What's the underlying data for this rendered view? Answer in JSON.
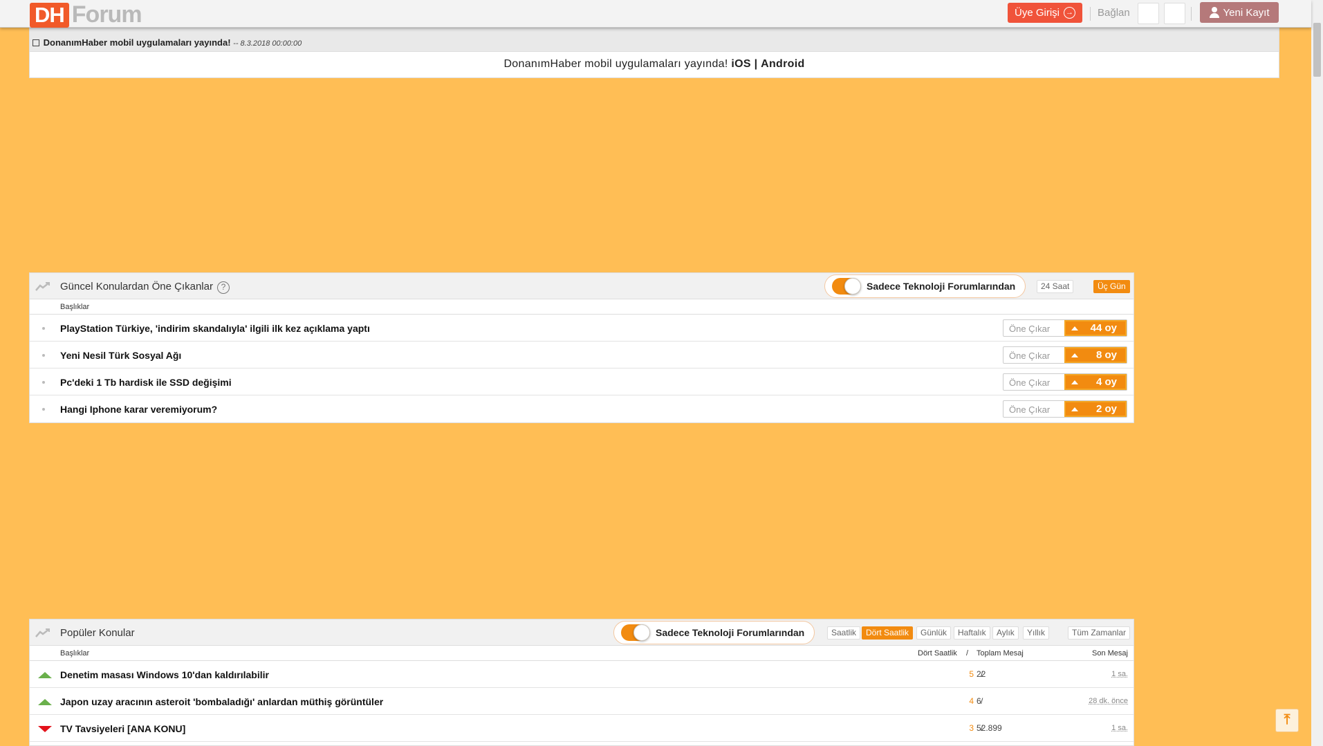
{
  "header": {
    "logo_dh": "DH",
    "logo_forum": "Forum",
    "login_label": "Üye Girişi",
    "connect_label": "Bağlan",
    "register_label": "Yeni Kayıt"
  },
  "announcement": {
    "title": "DonanımHaber mobil uygulamaları yayında!",
    "date": "-- 8.3.2018 00:00:00",
    "body_text": "DonanımHaber mobil uygulamaları yayında!",
    "ios": "iOS",
    "separator": "|",
    "android": "Android"
  },
  "featured": {
    "title": "Güncel Konulardan Öne Çıkanlar",
    "help": "?",
    "toggle_label": "Sadece Teknoloji Forumlarından",
    "toggle_on": true,
    "tabs": [
      {
        "label": "24 Saat",
        "active": false
      },
      {
        "label": "Üç Gün",
        "active": true
      }
    ],
    "col_header": "Başlıklar",
    "vote_label": "Öne Çıkar",
    "rows": [
      {
        "title": "PlayStation Türkiye, 'indirim skandalıyla' ilgili ilk kez açıklama yaptı",
        "votes": "44 oy"
      },
      {
        "title": "Yeni Nesil Türk Sosyal Ağı",
        "votes": "8 oy"
      },
      {
        "title": "Pc'deki 1 Tb hardisk ile SSD değişimi",
        "votes": "4 oy"
      },
      {
        "title": "Hangi Iphone karar veremiyorum?",
        "votes": "2 oy"
      }
    ]
  },
  "popular": {
    "title": "Popüler Konular",
    "toggle_label": "Sadece Teknoloji Forumlarından",
    "toggle_on": true,
    "tabs": [
      {
        "label": "Saatlik",
        "active": false
      },
      {
        "label": "Dört Saatlik",
        "active": true
      },
      {
        "label": "Günlük",
        "active": false
      },
      {
        "label": "Haftalık",
        "active": false
      },
      {
        "label": "Aylık",
        "active": false
      },
      {
        "label": "Yıllık",
        "active": false
      },
      {
        "label": "Tüm Zamanlar",
        "active": false
      }
    ],
    "col_headers": {
      "titles": "Başlıklar",
      "four_hour": "Dört Saatlik",
      "slash": "/",
      "total": "Toplam Mesaj",
      "last": "Son Mesaj"
    },
    "rows": [
      {
        "title": "Denetim masası Windows 10'dan kaldırılabilir",
        "trend": "up",
        "four_hour": "5",
        "total": "22",
        "last": "1 sa."
      },
      {
        "title": "Japon uzay aracının asteroit 'bombaladığı' anlardan müthiş görüntüler",
        "trend": "up",
        "four_hour": "4",
        "total": "6",
        "last": "28 dk. önce"
      },
      {
        "title": "TV Tavsiyeleri [ANA KONU]",
        "trend": "down",
        "four_hour": "3",
        "total": "52.899",
        "last": "1 sa."
      }
    ]
  },
  "colors": {
    "page_bg": "#ffbe55",
    "brand": "#f15a29",
    "accent": "#f28b10",
    "register": "#b5797a"
  },
  "icons": {
    "login": "arrow-circle-icon",
    "register": "user-icon",
    "trend": "trend-line-icon",
    "scroll_top": "scroll-to-top-icon"
  },
  "scroll_to_top_glyph": "⤒"
}
